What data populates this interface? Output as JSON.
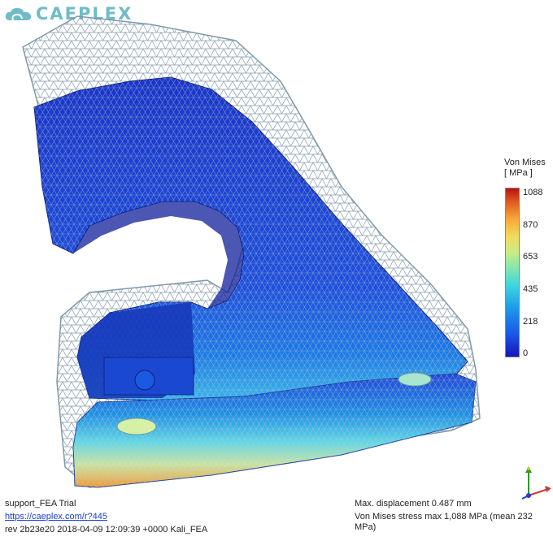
{
  "brand": {
    "name": "CAEPLEX",
    "color": "#6fbcc7"
  },
  "legend": {
    "title_line1": "Von Mises",
    "title_line2": "[ MPa ]",
    "ticks": [
      "1088",
      "870",
      "653",
      "435",
      "218",
      "0"
    ]
  },
  "footer": {
    "project": "support_FEA Trial",
    "link": "https://caeplex.com/r?445",
    "revision": "rev 2b23e20 2018-04-09 12:09:39 +0000 Kali_FEA",
    "max_displacement": "Max. displacement 0.487 mm",
    "stress_summary": "Von Mises stress max 1,088 MPa (mean 232 MPa)"
  },
  "icons": {
    "logo": "cloud-icon",
    "axes": "xyz-axes-icon"
  },
  "colors": {
    "stress_low": "#1515b8",
    "stress_high": "#b41414",
    "mesh": "#8fa3b0"
  }
}
